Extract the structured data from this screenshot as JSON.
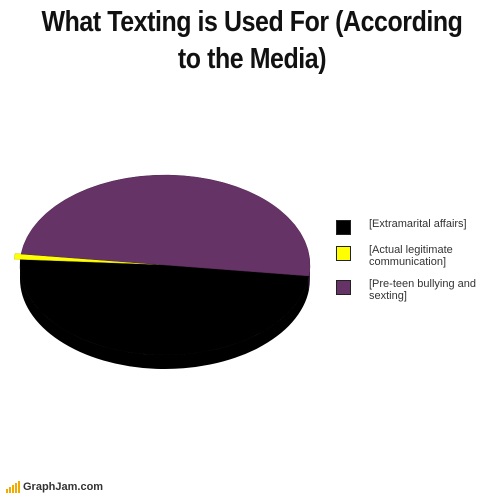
{
  "chart_data": {
    "type": "pie",
    "title": "What Texting is Used For (According to the Media)",
    "categories": [
      "[Extramarital affairs]",
      "[Actual legitimate communication]",
      "[Pre-teen bullying and sexting]"
    ],
    "values": [
      49,
      1,
      50
    ],
    "colors": [
      "#000000",
      "#ffff00",
      "#663366"
    ],
    "legend_position": "right",
    "exploded": "[Actual legitimate communication]"
  },
  "legend": [
    {
      "label": "[Extramarital affairs]",
      "color": "#000000"
    },
    {
      "label": "[Actual legitimate communication]",
      "color": "#ffff00"
    },
    {
      "label": "[Pre-teen bullying and sexting]",
      "color": "#663366"
    }
  ],
  "watermark": "GraphJam.com"
}
